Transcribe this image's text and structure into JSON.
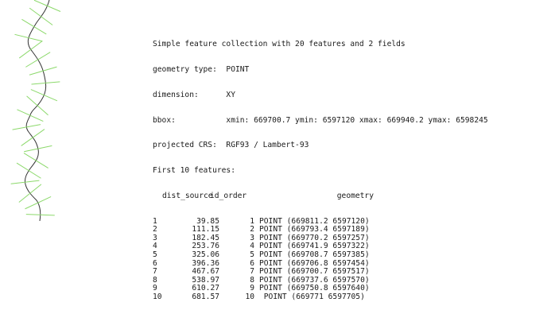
{
  "header": {
    "summary": "Simple feature collection with 20 features and 2 fields",
    "geometry_type": "geometry type:  POINT",
    "dimension": "dimension:      XY",
    "bbox": "bbox:           xmin: 669700.7 ymin: 6597120 xmax: 669940.2 ymax: 6598245",
    "crs": "projected CRS:  RGF93 / Lambert-93",
    "first_n": "First 10 features:"
  },
  "table": {
    "columns": [
      "dist_source",
      "id_order",
      "geometry"
    ],
    "rows": [
      {
        "idx": "1",
        "dist": "39.85",
        "id": "1",
        "geom": "POINT (669811.2 6597120)"
      },
      {
        "idx": "2",
        "dist": "111.15",
        "id": "2",
        "geom": "POINT (669793.4 6597189)"
      },
      {
        "idx": "3",
        "dist": "182.45",
        "id": "3",
        "geom": "POINT (669770.2 6597257)"
      },
      {
        "idx": "4",
        "dist": "253.76",
        "id": "4",
        "geom": "POINT (669741.9 6597322)"
      },
      {
        "idx": "5",
        "dist": "325.06",
        "id": "5",
        "geom": "POINT (669708.7 6597385)"
      },
      {
        "idx": "6",
        "dist": "396.36",
        "id": "6",
        "geom": "POINT (669706.8 6597454)"
      },
      {
        "idx": "7",
        "dist": "467.67",
        "id": "7",
        "geom": "POINT (669700.7 6597517)"
      },
      {
        "idx": "8",
        "dist": "538.97",
        "id": "8",
        "geom": "POINT (669737.6 6597570)"
      },
      {
        "idx": "9",
        "dist": "610.27",
        "id": "9",
        "geom": "POINT (669750.8 6597640)"
      },
      {
        "idx": "10",
        "dist": "681.57",
        "id": "10",
        "geom": " POINT (669771 6597705)"
      }
    ]
  },
  "map": {
    "line_color": "#333333",
    "tick_color": "#8cd96b"
  }
}
